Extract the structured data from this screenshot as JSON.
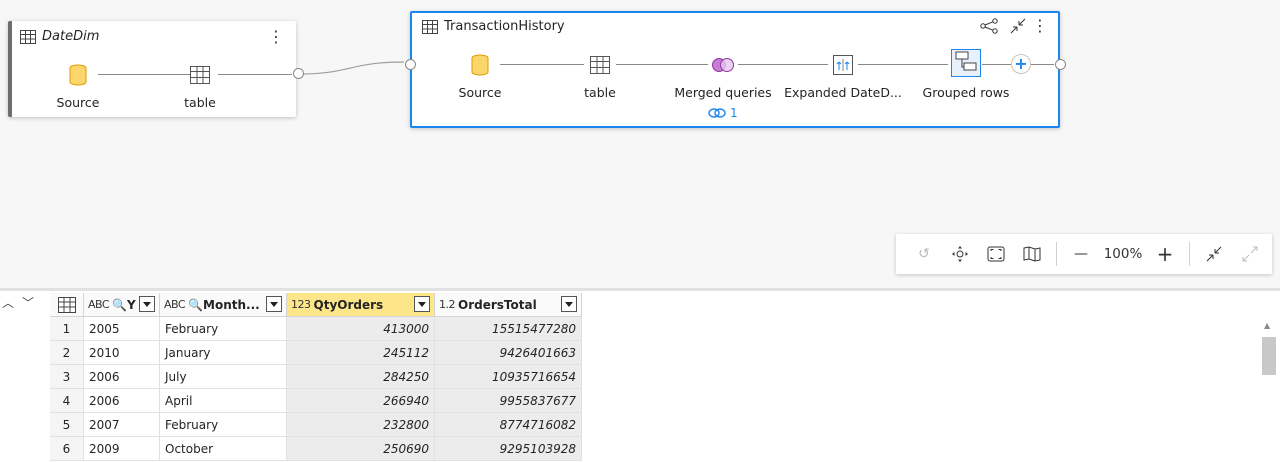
{
  "diagram": {
    "datedim": {
      "title": "DateDim",
      "steps": [
        {
          "label": "Source",
          "icon": "database-icon"
        },
        {
          "label": "table",
          "icon": "table-icon"
        }
      ]
    },
    "transaction": {
      "title": "TransactionHistory",
      "steps": [
        {
          "label": "Source",
          "icon": "database-icon"
        },
        {
          "label": "table",
          "icon": "table-icon"
        },
        {
          "label": "Merged queries",
          "icon": "merge-icon"
        },
        {
          "label": "Expanded DateD...",
          "icon": "expand-columns-icon"
        },
        {
          "label": "Grouped rows",
          "icon": "group-rows-icon"
        }
      ],
      "link_count": "1"
    }
  },
  "zoom": {
    "value": "100%"
  },
  "grid": {
    "columns": [
      {
        "type": "ABC",
        "name": "Y"
      },
      {
        "type": "ABC",
        "name": "Month..."
      },
      {
        "type": "123",
        "name": "QtyOrders"
      },
      {
        "type": "1.2",
        "name": "OrdersTotal"
      }
    ],
    "rows": [
      {
        "idx": "1",
        "year": "2005",
        "month": "February",
        "qty": "413000",
        "total": "15515477280"
      },
      {
        "idx": "2",
        "year": "2010",
        "month": "January",
        "qty": "245112",
        "total": "9426401663"
      },
      {
        "idx": "3",
        "year": "2006",
        "month": "July",
        "qty": "284250",
        "total": "10935716654"
      },
      {
        "idx": "4",
        "year": "2006",
        "month": "April",
        "qty": "266940",
        "total": "9955837677"
      },
      {
        "idx": "5",
        "year": "2007",
        "month": "February",
        "qty": "232800",
        "total": "8774716082"
      },
      {
        "idx": "6",
        "year": "2009",
        "month": "October",
        "qty": "250690",
        "total": "9295103928"
      }
    ]
  },
  "colors": {
    "accent": "#1a86f0",
    "db": "#f2a900",
    "merge": "#b44fc7",
    "highlight": "#fde68a"
  }
}
